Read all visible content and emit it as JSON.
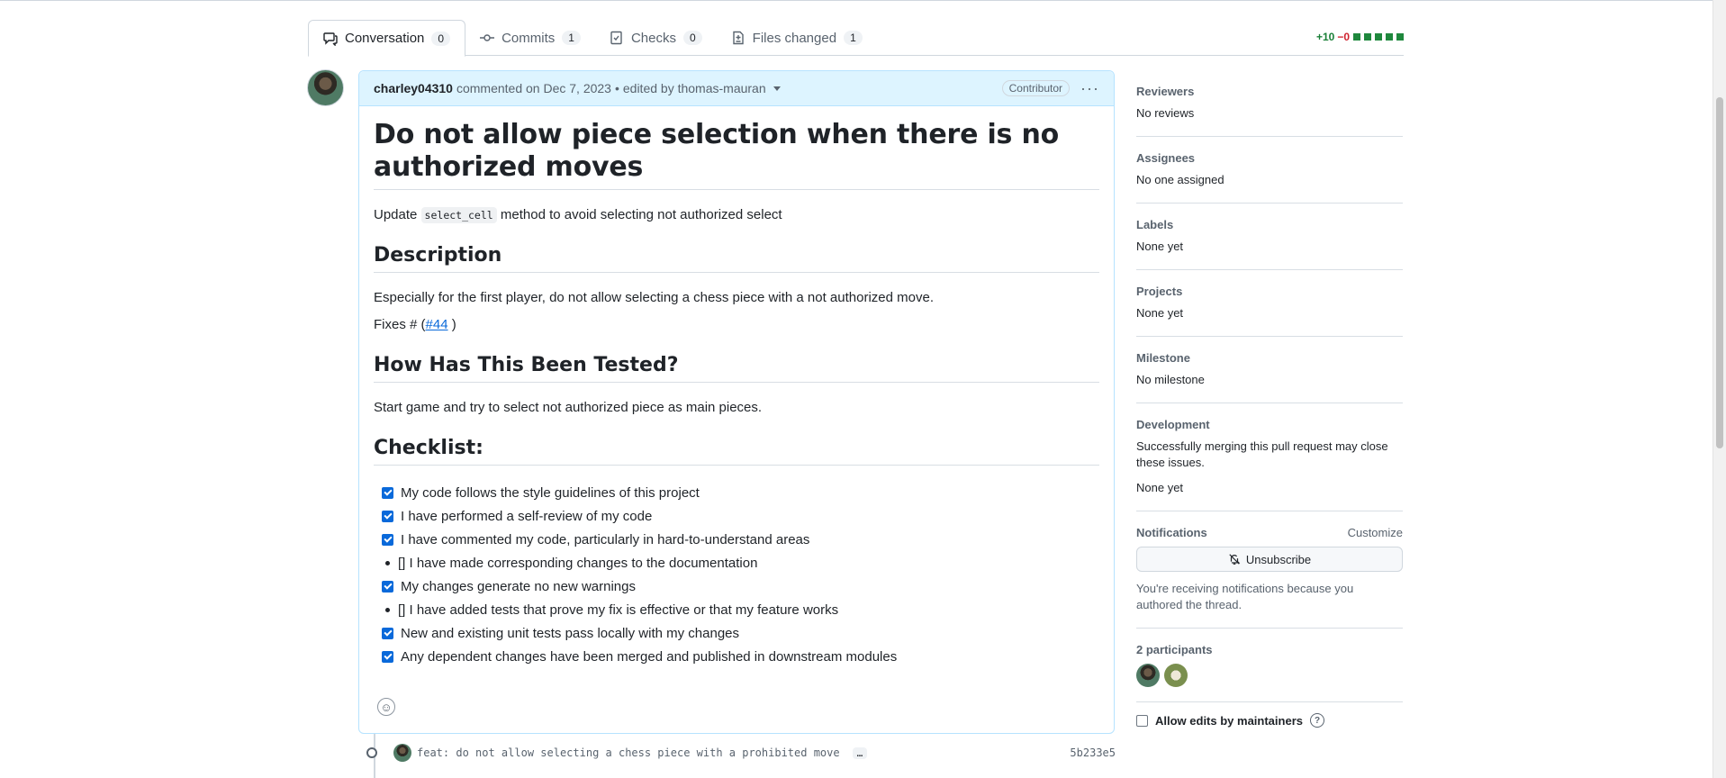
{
  "tabs": [
    {
      "label": "Conversation",
      "count": "0"
    },
    {
      "label": "Commits",
      "count": "1"
    },
    {
      "label": "Checks",
      "count": "0"
    },
    {
      "label": "Files changed",
      "count": "1"
    }
  ],
  "diffstat": {
    "additions": "+10",
    "deletions": "−0"
  },
  "comment": {
    "author": "charley04310",
    "action": "commented on Dec 7, 2023",
    "separator": "•",
    "edited": "edited by thomas-mauran",
    "badge": "Contributor",
    "title": "Do not allow piece selection when there is no authorized moves",
    "intro_before": "Update",
    "intro_code": "select_cell",
    "intro_after": "method to avoid selecting not authorized select",
    "h_description": "Description",
    "description": "Especially for the first player, do not allow selecting a chess piece with a not authorized move.",
    "fixes_before": "Fixes # (",
    "fixes_link": "#44",
    "fixes_after": ")",
    "h_tested": "How Has This Been Tested?",
    "tested": "Start game and try to select not authorized piece as main pieces.",
    "h_checklist": "Checklist:",
    "checklist": [
      {
        "text": "My code follows the style guidelines of this project",
        "checked": true
      },
      {
        "text": "I have performed a self-review of my code",
        "checked": true
      },
      {
        "text": "I have commented my code, particularly in hard-to-understand areas",
        "checked": true
      },
      {
        "text": "[] I have made corresponding changes to the documentation",
        "checked": false
      },
      {
        "text": "My changes generate no new warnings",
        "checked": true
      },
      {
        "text": "[] I have added tests that prove my fix is effective or that my feature works",
        "checked": false
      },
      {
        "text": "New and existing unit tests pass locally with my changes",
        "checked": true
      },
      {
        "text": "Any dependent changes have been merged and published in downstream modules",
        "checked": true
      }
    ]
  },
  "commit": {
    "message": "feat: do not allow selecting a chess piece with a prohibited move",
    "ellipsis": "…",
    "sha": "5b233e5"
  },
  "sidebar": {
    "reviewers": {
      "heading": "Reviewers",
      "value": "No reviews"
    },
    "assignees": {
      "heading": "Assignees",
      "value": "No one assigned"
    },
    "labels": {
      "heading": "Labels",
      "value": "None yet"
    },
    "projects": {
      "heading": "Projects",
      "value": "None yet"
    },
    "milestone": {
      "heading": "Milestone",
      "value": "No milestone"
    },
    "development": {
      "heading": "Development",
      "text": "Successfully merging this pull request may close these issues.",
      "value": "None yet"
    },
    "notifications": {
      "heading": "Notifications",
      "customize": "Customize",
      "button": "Unsubscribe",
      "note": "You're receiving notifications because you authored the thread."
    },
    "participants": {
      "heading": "2 participants"
    },
    "allow_edits": "Allow edits by maintainers"
  }
}
